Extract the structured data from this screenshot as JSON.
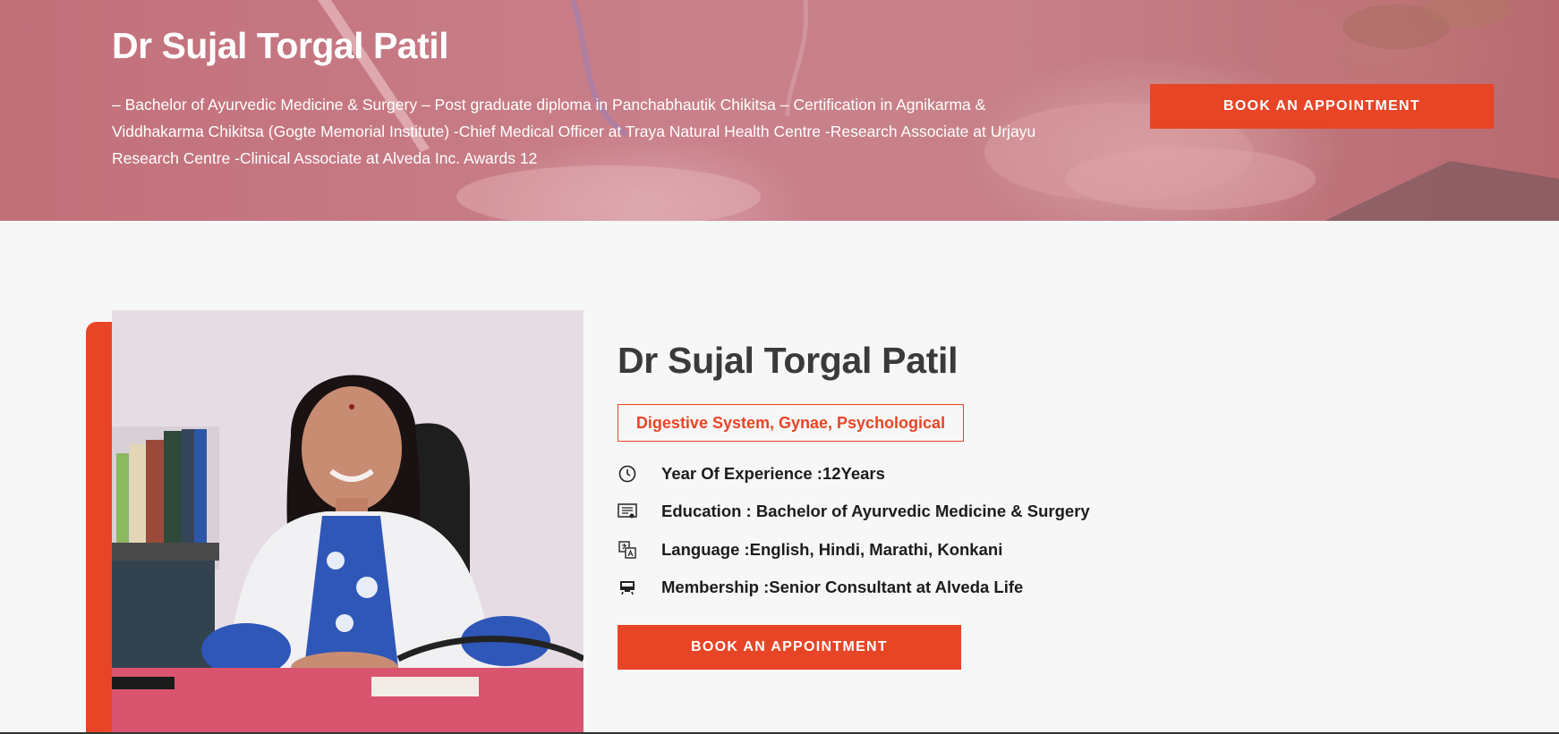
{
  "hero": {
    "title": "Dr Sujal Torgal Patil",
    "description": "– Bachelor of Ayurvedic Medicine & Surgery – Post graduate diploma in Panchabhautik Chikitsa – Certification in Agnikarma & Viddhakarma Chikitsa (Gogte Memorial Institute) -Chief Medical Officer at Traya Natural Health Centre -Research Associate at Urjayu Research Centre -Clinical Associate at Alveda Inc. Awards 12",
    "button_label": "BOOK AN APPOINTMENT"
  },
  "profile": {
    "name": "Dr Sujal Torgal Patil",
    "specialties": "Digestive System, Gynae, Psychological",
    "details": [
      {
        "icon": "clock-icon",
        "text": "Year Of Experience :12Years"
      },
      {
        "icon": "certificate-icon",
        "text": "Education : Bachelor of Ayurvedic Medicine & Surgery"
      },
      {
        "icon": "translate-icon",
        "text": "Language :English, Hindi, Marathi, Konkani"
      },
      {
        "icon": "membership-card-icon",
        "text": "Membership :Senior Consultant at Alveda Life"
      }
    ],
    "button_label": "BOOK AN APPOINTMENT"
  },
  "colors": {
    "accent": "#e84526",
    "hero_overlay": "#c47880",
    "heading": "#3a3a3a",
    "page_background": "#f7f7f7"
  }
}
